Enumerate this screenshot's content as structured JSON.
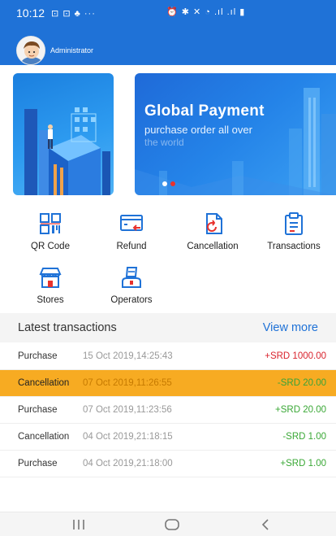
{
  "status_bar": {
    "time": "10:12",
    "left_icons": "⊡ ⊡ ♣ ···",
    "right_icons": "⏰ ✱ ✕ ◔ .ıl .ıl ▮"
  },
  "user": {
    "name": "Administrator"
  },
  "banner": {
    "title": "Global Payment",
    "subtitle": "purchase order all over",
    "subtitle2": "the world",
    "slide_count": 2,
    "active_slide": 1
  },
  "menu": [
    {
      "id": "qr-code",
      "label": "QR Code",
      "icon": "qr-code-icon"
    },
    {
      "id": "refund",
      "label": "Refund",
      "icon": "refund-icon"
    },
    {
      "id": "cancellation",
      "label": "Cancellation",
      "icon": "cancellation-icon"
    },
    {
      "id": "transactions",
      "label": "Transactions",
      "icon": "clipboard-icon"
    },
    {
      "id": "stores",
      "label": "Stores",
      "icon": "store-icon"
    },
    {
      "id": "operators",
      "label": "Operators",
      "icon": "operator-icon"
    }
  ],
  "transactions_section": {
    "title": "Latest transactions",
    "view_more": "View more",
    "rows": [
      {
        "type": "Purchase",
        "date": "15 Oct 2019,14:25:43",
        "amount": "+SRD 1000.00",
        "amount_color": "#d9232d"
      },
      {
        "type": "Cancellation",
        "date": "07 Oct 2019,11:26:55",
        "amount": "-SRD 20.00",
        "amount_color": "#38a33a",
        "highlight": true
      },
      {
        "type": "Purchase",
        "date": "07 Oct 2019,11:23:56",
        "amount": "+SRD 20.00",
        "amount_color": "#3aa836"
      },
      {
        "type": "Cancellation",
        "date": "04 Oct 2019,21:18:15",
        "amount": "-SRD 1.00",
        "amount_color": "#3aa836"
      },
      {
        "type": "Purchase",
        "date": "04 Oct 2019,21:18:00",
        "amount": "+SRD 1.00",
        "amount_color": "#3aa836"
      }
    ]
  },
  "nav": {
    "recents": "recents-icon",
    "home": "home-icon",
    "back": "back-icon"
  },
  "colors": {
    "primary": "#1f72d7",
    "highlight": "#f7ab22",
    "negative": "#d9232d",
    "positive": "#3aa836"
  }
}
